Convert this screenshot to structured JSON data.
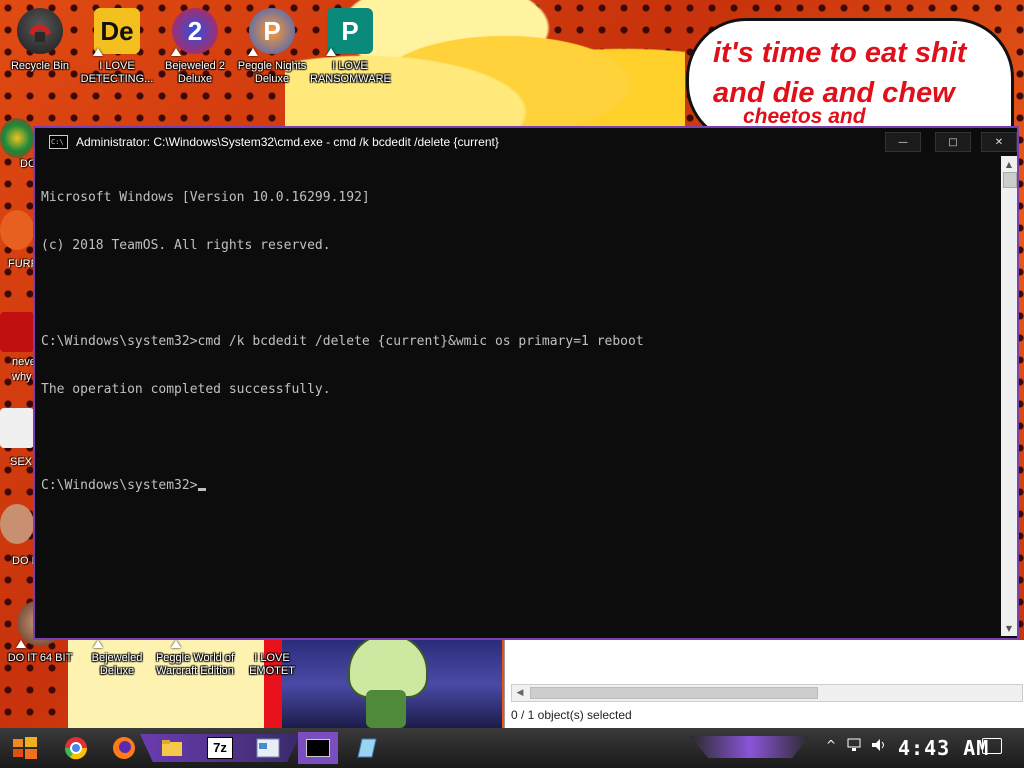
{
  "desktop": {
    "speech_bubble": {
      "line1": "it's time to eat shit",
      "line2": "and die and chew",
      "line3": "cheetos and"
    },
    "icons": [
      {
        "label": "Recycle Bin",
        "icon": "recycle-bin-icon"
      },
      {
        "label": "I LOVE DETECTING...",
        "icon": "detecting-app-icon"
      },
      {
        "label": "Bejeweled 2 Deluxe",
        "icon": "bejeweled-2-icon"
      },
      {
        "label": "Peggle Nights Deluxe",
        "icon": "peggle-nights-icon"
      },
      {
        "label": "I LOVE RANSOMWARE",
        "icon": "publisher-icon"
      },
      {
        "label": "DO IT 64 BIT",
        "icon": "portrait-icon"
      },
      {
        "label": "Bejeweled Deluxe",
        "icon": "bejeweled-icon"
      },
      {
        "label": "Peggle World of Warcraft Edition",
        "icon": "peggle-wow-icon"
      },
      {
        "label": "I LOVE EMOTET",
        "icon": "emotet-icon"
      }
    ],
    "side_labels": [
      "DO",
      "FURF",
      "neve",
      "why",
      "SEX",
      "DO I"
    ]
  },
  "cmd": {
    "title": "Administrator: C:\\Windows\\System32\\cmd.exe - cmd  /k bcdedit /delete {current}",
    "lines": [
      "Microsoft Windows [Version 10.0.16299.192]",
      "(c) 2018 TeamOS. All rights reserved.",
      "",
      "C:\\Windows\\system32>cmd /k bcdedit /delete {current}&wmic os primary=1 reboot",
      "The operation completed successfully.",
      "",
      "C:\\Windows\\system32>"
    ]
  },
  "explorer": {
    "status": "0 / 1 object(s) selected"
  },
  "taskbar": {
    "apps": [
      "start",
      "chrome",
      "firefox",
      "file-explorer",
      "7zip",
      "control-panel",
      "cmd",
      "notepad"
    ],
    "clock": "4:43 AM"
  },
  "colors": {
    "accent": "#7a3fb0",
    "cmd_bg": "#0c0c0c",
    "cmd_text": "#c0c0c0",
    "speech_text": "#e0101a"
  }
}
